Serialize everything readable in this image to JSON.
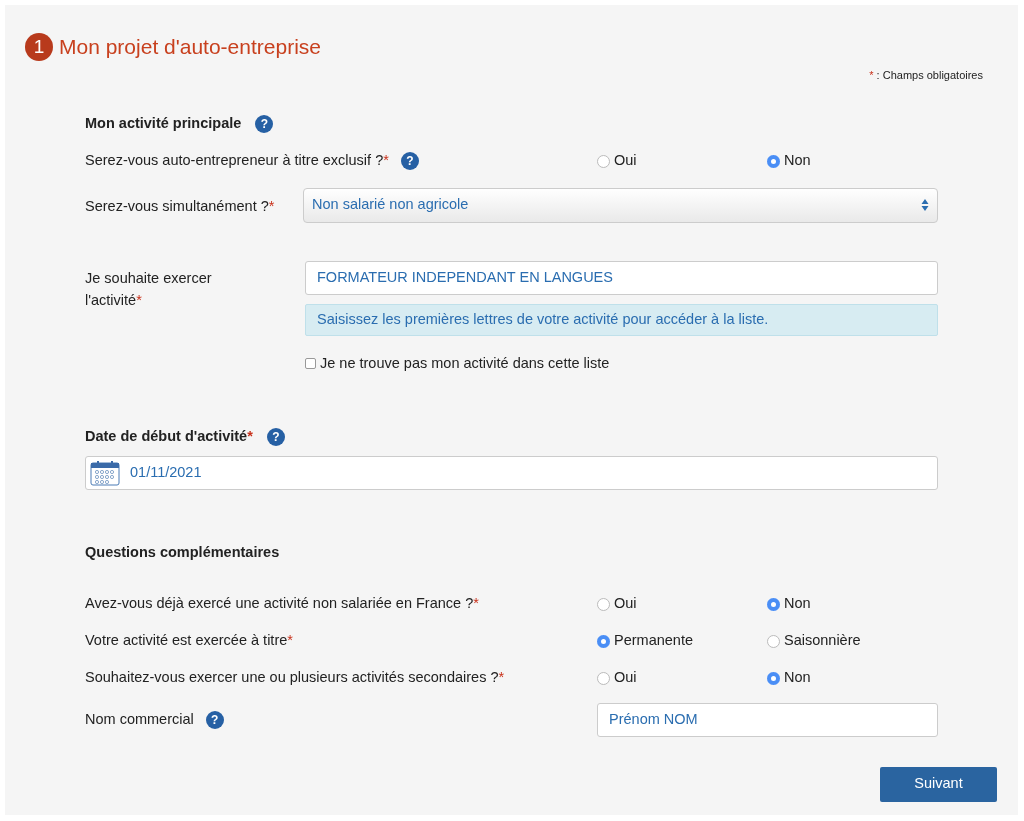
{
  "header": {
    "step": "1",
    "title": "Mon projet d'auto-entreprise"
  },
  "legend": {
    "mark": "*",
    "text": " : Champs obligatoires"
  },
  "sections": [
    {
      "title": "Mon activité principale",
      "help": "?",
      "fields": [
        {
          "kind": "radio",
          "label": "Serez-vous auto-entrepreneur à titre exclusif ?",
          "mark": "*",
          "help": "?",
          "options": [
            {
              "label": "Oui",
              "selected": false
            },
            {
              "label": "Non",
              "selected": true
            }
          ]
        },
        {
          "kind": "select",
          "label": "Serez-vous simultanément ?",
          "mark": "*",
          "value": "Non salarié non agricole"
        },
        {
          "kind": "autocomplete",
          "label": "Je souhaite exercer l'activité",
          "mark": "*",
          "value": "FORMATEUR INDEPENDANT EN LANGUES",
          "hint": "Saisissez les premières lettres de votre activité pour accéder à la liste.",
          "checkbox": {
            "label": "Je ne trouve pas mon activité dans cette liste",
            "checked": false
          }
        }
      ]
    },
    {
      "title": "Date de début d'activité",
      "mark": "*",
      "help": "?",
      "fields": [
        {
          "kind": "date",
          "value": "01/11/2021"
        }
      ]
    },
    {
      "title": "Questions complémentaires",
      "fields": [
        {
          "kind": "radio",
          "label": "Avez-vous déjà exercé une activité non salariée en France ?",
          "mark": "*",
          "options": [
            {
              "label": "Oui",
              "selected": false
            },
            {
              "label": "Non",
              "selected": true
            }
          ]
        },
        {
          "kind": "radio",
          "label": "Votre activité est exercée à titre",
          "mark": "*",
          "options": [
            {
              "label": "Permanente",
              "selected": true
            },
            {
              "label": "Saisonnière",
              "selected": false
            }
          ]
        },
        {
          "kind": "radio",
          "label": "Souhaitez-vous exercer une ou plusieurs activités secondaires ?",
          "mark": "*",
          "options": [
            {
              "label": "Oui",
              "selected": false
            },
            {
              "label": "Non",
              "selected": true
            }
          ]
        },
        {
          "kind": "text",
          "label": "Nom commercial",
          "help": "?",
          "value": "Prénom NOM"
        }
      ]
    }
  ],
  "next_button": "Suivant"
}
